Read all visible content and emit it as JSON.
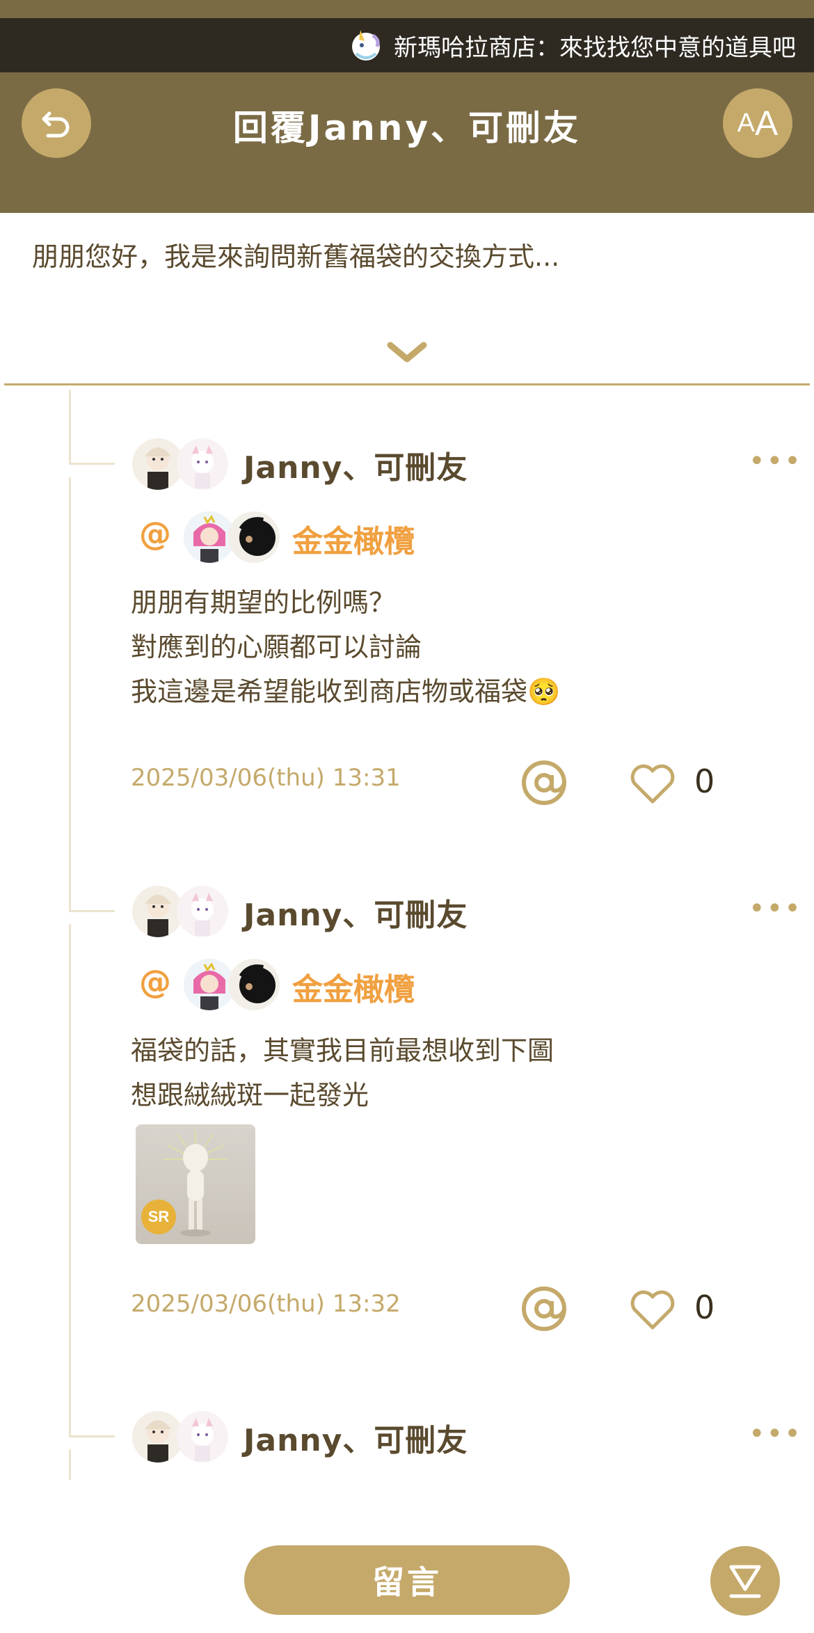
{
  "marquee": {
    "text": "新瑪哈拉商店：來找找您中意的道具吧",
    "icon": "unicorn-icon"
  },
  "header": {
    "title": "回覆Janny、可刪友",
    "back_icon": "back-arrow-icon",
    "font_size_icon": "font-size-icon",
    "font_small": "A",
    "font_large": "A"
  },
  "preview": {
    "text": "朋朋您好，我是來詢問新舊福袋的交換方式...",
    "expand_icon": "chevron-down-icon"
  },
  "replies": [
    {
      "username": "Janny、可刪友",
      "more": "•••",
      "mention_symbol": "@",
      "mention_name": "金金橄欖",
      "lines": [
        "朋朋有期望的比例嗎？",
        "對應到的心願都可以討論",
        "我這邊是希望能收到商店物或福袋🥺"
      ],
      "timestamp": "2025/03/06(thu) 13:31",
      "likes": "0"
    },
    {
      "username": "Janny、可刪友",
      "more": "•••",
      "mention_symbol": "@",
      "mention_name": "金金橄欖",
      "lines": [
        "福袋的話，其實我目前最想收到下圖",
        "想跟絨絨斑一起發光"
      ],
      "image_badge": "SR",
      "timestamp": "2025/03/06(thu) 13:32",
      "likes": "0"
    },
    {
      "username": "Janny、可刪友",
      "more": "•••"
    }
  ],
  "footer": {
    "comment_label": "留言",
    "scroll_icon": "scroll-to-bottom-icon"
  },
  "colors": {
    "header_bg": "#7a6b45",
    "accent": "#c4a96a",
    "mention": "#f0a040",
    "text": "#5a4a2e"
  }
}
